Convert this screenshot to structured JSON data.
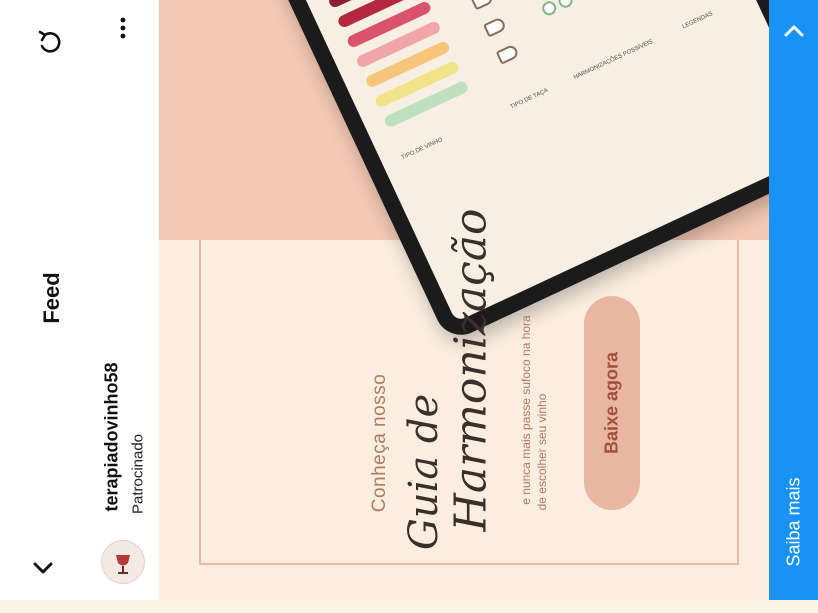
{
  "topbar": {
    "back_icon": "chevron-down-icon",
    "title": "Feed",
    "refresh_icon": "refresh-icon"
  },
  "post": {
    "username": "terapiadovinho58",
    "sponsored": "Patrocinado",
    "menu_icon": "more-vertical-icon"
  },
  "ad": {
    "intro": "Conheça nosso",
    "script_title_1": "Guia de",
    "script_title_2": "Harmonização",
    "subtitle_1": "e nunca mais passe sufoco na hora",
    "subtitle_2": "de escolher seu vinho",
    "button": "Baixe agora",
    "tablet_labels": [
      "TIPO DE VINHO",
      "TIPO DE TAÇA",
      "HARMONIZAÇÕES POSSÍVEIS",
      "LEGENDAS"
    ]
  },
  "cta": {
    "label": "Saiba mais",
    "icon": "chevron-up-icon"
  },
  "colors": {
    "accent": "#1893f5",
    "peach": "#f3c8b4",
    "button": "#e9b6a1",
    "text_brown": "#b07a63"
  }
}
